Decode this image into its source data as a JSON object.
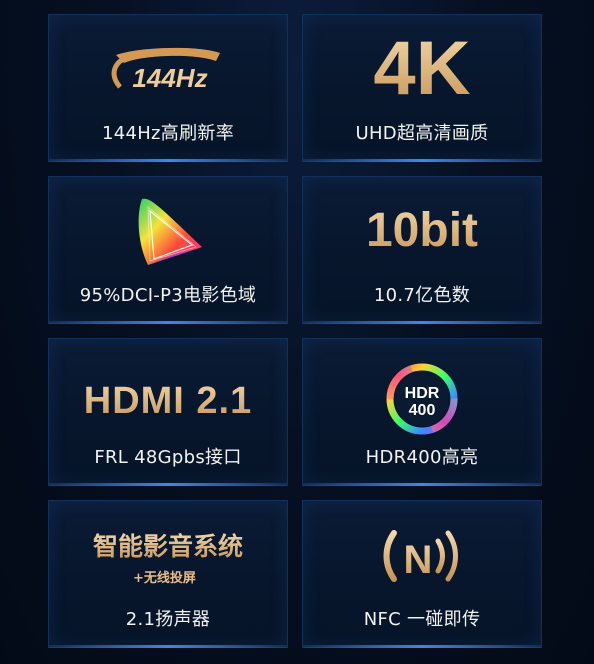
{
  "features": [
    {
      "id": "refresh",
      "badge": "144Hz",
      "caption": "144Hz高刷新率"
    },
    {
      "id": "resolution",
      "badge": "4K",
      "caption": "UHD超高清画质"
    },
    {
      "id": "gamut",
      "caption": "95%DCI-P3电影色域"
    },
    {
      "id": "bitdepth",
      "badge": "10bit",
      "caption": "10.7亿色数"
    },
    {
      "id": "hdmi",
      "badge": "HDMI 2.1",
      "caption": "FRL 48Gpbs接口"
    },
    {
      "id": "hdr",
      "badge_line1": "HDR",
      "badge_line2": "400",
      "caption": "HDR400高亮"
    },
    {
      "id": "smart",
      "badge": "智能影音系统",
      "subbadge": "+无线投屏",
      "caption": "2.1扬声器"
    },
    {
      "id": "nfc",
      "badge": "N",
      "caption": "NFC 一碰即传"
    }
  ],
  "colors": {
    "gold": "#e0b47a",
    "card_border": "#12305a",
    "accent_blue": "#3f86e6"
  }
}
